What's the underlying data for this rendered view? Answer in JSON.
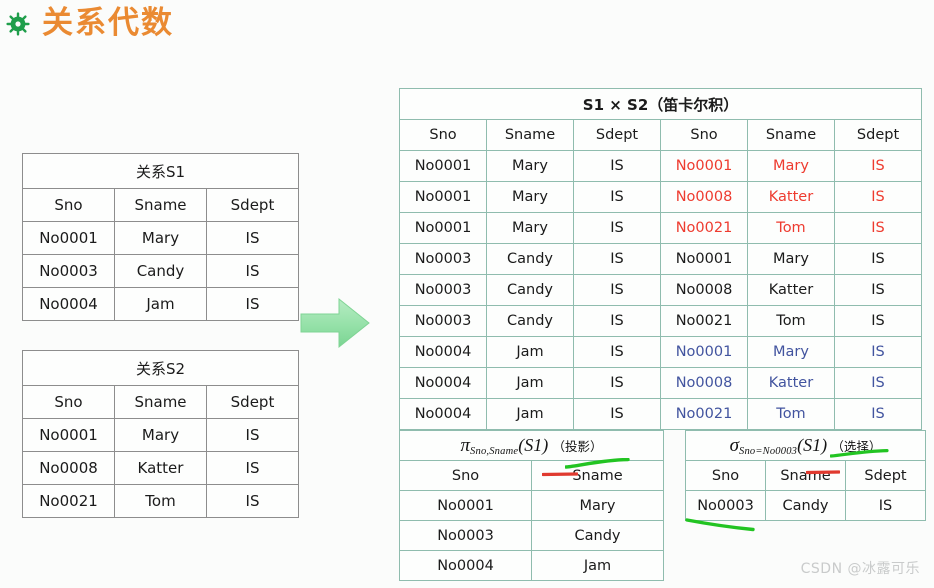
{
  "slide": {
    "title": "关系代数",
    "bullet_icon": "flower-gear-ornament-icon",
    "title_color": "#ea8a32",
    "background_color": "#fbfcfb",
    "arrow_icon": "right-arrow-icon",
    "arrow_color": "#8de0a2",
    "watermark": "CSDN @冰露可乐"
  },
  "colors": {
    "gray_border": "#8d8d8d",
    "teal_border": "#8fbcae",
    "red_text": "#ee3b2f",
    "blue_text": "#42549f",
    "black_text": "#1b1b1b",
    "annotate_red": "#e03a2f",
    "annotate_green": "#22c422"
  },
  "tables": {
    "s1": {
      "caption": "关系S1",
      "columns": [
        "Sno",
        "Sname",
        "Sdept"
      ],
      "rows": [
        [
          "No0001",
          "Mary",
          "IS"
        ],
        [
          "No0003",
          "Candy",
          "IS"
        ],
        [
          "No0004",
          "Jam",
          "IS"
        ]
      ]
    },
    "s2": {
      "caption": "关系S2",
      "columns": [
        "Sno",
        "Sname",
        "Sdept"
      ],
      "rows": [
        [
          "No0001",
          "Mary",
          "IS"
        ],
        [
          "No0008",
          "Katter",
          "IS"
        ],
        [
          "No0021",
          "Tom",
          "IS"
        ]
      ]
    },
    "cartesian": {
      "caption": "S1 × S2（笛卡尔积）",
      "columns": [
        "Sno",
        "Sname",
        "Sdept",
        "Sno",
        "Sname",
        "Sdept"
      ],
      "rows": [
        {
          "left": [
            "No0001",
            "Mary",
            "IS"
          ],
          "right": [
            "No0001",
            "Mary",
            "IS"
          ],
          "right_color": "red"
        },
        {
          "left": [
            "No0001",
            "Mary",
            "IS"
          ],
          "right": [
            "No0008",
            "Katter",
            "IS"
          ],
          "right_color": "red"
        },
        {
          "left": [
            "No0001",
            "Mary",
            "IS"
          ],
          "right": [
            "No0021",
            "Tom",
            "IS"
          ],
          "right_color": "red"
        },
        {
          "left": [
            "No0003",
            "Candy",
            "IS"
          ],
          "right": [
            "No0001",
            "Mary",
            "IS"
          ],
          "right_color": "black"
        },
        {
          "left": [
            "No0003",
            "Candy",
            "IS"
          ],
          "right": [
            "No0008",
            "Katter",
            "IS"
          ],
          "right_color": "black"
        },
        {
          "left": [
            "No0003",
            "Candy",
            "IS"
          ],
          "right": [
            "No0021",
            "Tom",
            "IS"
          ],
          "right_color": "black"
        },
        {
          "left": [
            "No0004",
            "Jam",
            "IS"
          ],
          "right": [
            "No0001",
            "Mary",
            "IS"
          ],
          "right_color": "blue"
        },
        {
          "left": [
            "No0004",
            "Jam",
            "IS"
          ],
          "right": [
            "No0008",
            "Katter",
            "IS"
          ],
          "right_color": "blue"
        },
        {
          "left": [
            "No0004",
            "Jam",
            "IS"
          ],
          "right": [
            "No0021",
            "Tom",
            "IS"
          ],
          "right_color": "blue"
        }
      ]
    },
    "projection": {
      "caption_formula": {
        "op": "π",
        "subscript": "Sno,Sname",
        "arg": "(S1)",
        "label": "（投影）"
      },
      "columns": [
        "Sno",
        "Sname"
      ],
      "rows": [
        [
          "No0001",
          "Mary"
        ],
        [
          "No0003",
          "Candy"
        ],
        [
          "No0004",
          "Jam"
        ]
      ]
    },
    "selection": {
      "caption_formula": {
        "op": "σ",
        "subscript": "Sno=No0003",
        "arg": "(S1)",
        "label": "（选择）"
      },
      "columns": [
        "Sno",
        "Sname",
        "Sdept"
      ],
      "rows": [
        [
          "No0003",
          "Candy",
          "IS"
        ]
      ]
    }
  }
}
